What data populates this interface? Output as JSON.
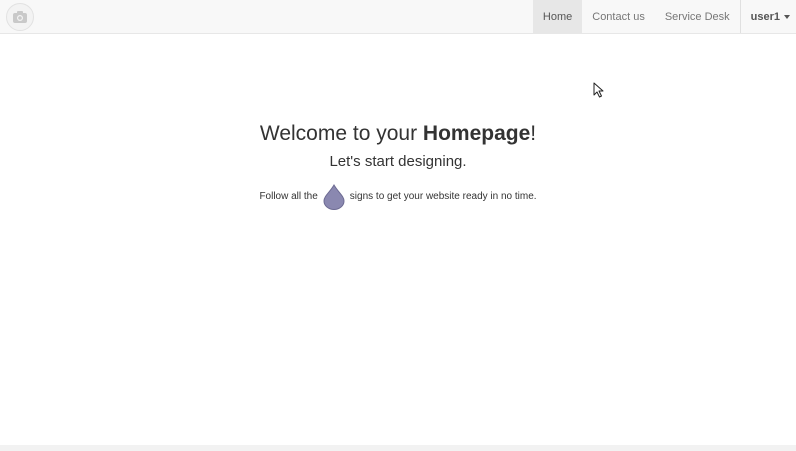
{
  "nav": {
    "items": [
      {
        "label": "Home",
        "active": true
      },
      {
        "label": "Contact us",
        "active": false
      },
      {
        "label": "Service Desk",
        "active": false
      }
    ],
    "user": "user1"
  },
  "hero": {
    "title_prefix": "Welcome to your ",
    "title_bold": "Homepage",
    "title_suffix": "!",
    "subtitle": "Let's start designing.",
    "hint_before": "Follow all the",
    "hint_after": "signs to get your website ready in no time."
  },
  "colors": {
    "drop": "#8a88b0",
    "drop_border": "#6d6b93",
    "navbar_bg": "#f8f8f8",
    "active_tab_bg": "#e7e7e7"
  },
  "icons": {
    "logo": "camera-icon",
    "drop": "droplet-icon",
    "cursor": "mouse-cursor-icon"
  }
}
